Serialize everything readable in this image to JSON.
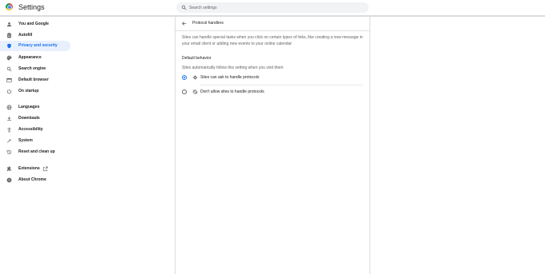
{
  "app": {
    "title": "Settings"
  },
  "search": {
    "placeholder": "Search settings"
  },
  "sidebar": {
    "items": [
      {
        "label": "You and Google",
        "icon": "person-icon"
      },
      {
        "label": "Autofill",
        "icon": "clipboard-icon"
      },
      {
        "label": "Privacy and security",
        "icon": "shield-icon",
        "selected": true
      },
      {
        "label": "Appearance",
        "icon": "palette-icon"
      },
      {
        "label": "Search engine",
        "icon": "search-icon"
      },
      {
        "label": "Default browser",
        "icon": "browser-icon"
      },
      {
        "label": "On startup",
        "icon": "power-icon"
      },
      {
        "label": "Languages",
        "icon": "globe-icon"
      },
      {
        "label": "Downloads",
        "icon": "download-icon"
      },
      {
        "label": "Accessibility",
        "icon": "accessibility-icon"
      },
      {
        "label": "System",
        "icon": "wrench-icon"
      },
      {
        "label": "Reset and clean up",
        "icon": "history-icon"
      },
      {
        "label": "Extensions",
        "icon": "puzzle-icon"
      },
      {
        "label": "About Chrome",
        "icon": "chrome-icon"
      }
    ]
  },
  "page": {
    "title": "Protocol handlers",
    "description": "Sites can handle special tasks when you click on certain types of links, like creating a new message in your email client or adding new events to your online calendar",
    "section_title": "Default behavior",
    "section_subtitle": "Sites automatically follow this setting when you visit them",
    "options": [
      {
        "label": "Sites can ask to handle protocols",
        "checked": true,
        "icon": "protocol-handler-icon"
      },
      {
        "label": "Don't allow sites to handle protocols",
        "checked": false,
        "icon": "protocol-handler-off-icon"
      }
    ]
  },
  "colors": {
    "accent": "#1a73e8",
    "selected_bg": "#e8f0fe",
    "divider": "#dadce0"
  }
}
